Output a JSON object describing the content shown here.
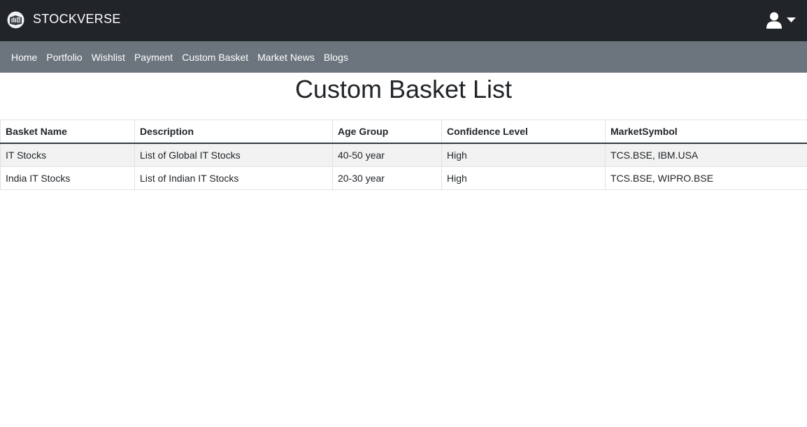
{
  "header": {
    "brand_name": "STOCKVERSE",
    "logo_icon": "stockverse-logo-icon",
    "user_icon": "user-icon",
    "caret_icon": "caret-down-icon",
    "colors": {
      "topbar": "#212529",
      "navbar": "#6c757d"
    }
  },
  "nav": {
    "items": [
      {
        "label": "Home"
      },
      {
        "label": "Portfolio"
      },
      {
        "label": "Wishlist"
      },
      {
        "label": "Payment"
      },
      {
        "label": "Custom Basket"
      },
      {
        "label": "Market News"
      },
      {
        "label": "Blogs"
      }
    ]
  },
  "main": {
    "title": "Custom Basket List",
    "table": {
      "columns": [
        "Basket Name",
        "Description",
        "Age Group",
        "Confidence Level",
        "MarketSymbol"
      ],
      "rows": [
        [
          "IT Stocks",
          "List of Global IT Stocks",
          "40-50 year",
          "High",
          "TCS.BSE, IBM.USA"
        ],
        [
          "India IT Stocks",
          "List of Indian IT Stocks",
          "20-30 year",
          "High",
          "TCS.BSE, WIPRO.BSE"
        ]
      ]
    }
  }
}
